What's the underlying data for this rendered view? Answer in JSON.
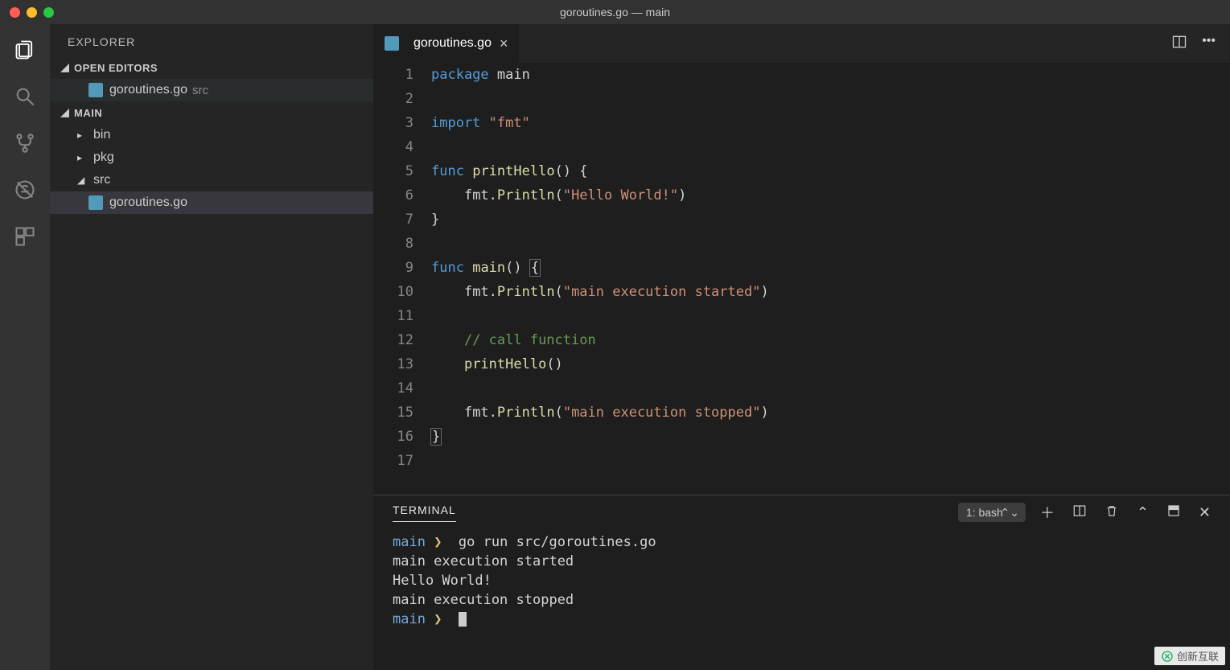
{
  "window": {
    "title": "goroutines.go — main"
  },
  "sidebar": {
    "title": "EXPLORER",
    "open_editors_label": "OPEN EDITORS",
    "open_editors": [
      {
        "name": "goroutines.go",
        "path": "src"
      }
    ],
    "workspace_label": "MAIN",
    "tree": [
      {
        "name": "bin",
        "type": "folder",
        "expanded": false
      },
      {
        "name": "pkg",
        "type": "folder",
        "expanded": false
      },
      {
        "name": "src",
        "type": "folder",
        "expanded": true,
        "children": [
          {
            "name": "goroutines.go",
            "type": "file",
            "active": true
          }
        ]
      }
    ]
  },
  "tabs": {
    "active": {
      "name": "goroutines.go"
    },
    "actions": {
      "split": "split-editor-icon",
      "more": "…"
    }
  },
  "code": {
    "raw": "package main\n\nimport \"fmt\"\n\nfunc printHello() {\n    fmt.Println(\"Hello World!\")\n}\n\nfunc main() {\n    fmt.Println(\"main execution started\")\n\n    // call function\n    printHello()\n\n    fmt.Println(\"main execution stopped\")\n}\n",
    "lines": [
      {
        "n": 1,
        "tokens": [
          [
            "package",
            "kw"
          ],
          [
            " ",
            "p"
          ],
          [
            "main",
            "id"
          ]
        ]
      },
      {
        "n": 2,
        "tokens": []
      },
      {
        "n": 3,
        "tokens": [
          [
            "import",
            "kw"
          ],
          [
            " ",
            "p"
          ],
          [
            "\"fmt\"",
            "str"
          ]
        ]
      },
      {
        "n": 4,
        "tokens": []
      },
      {
        "n": 5,
        "tokens": [
          [
            "func",
            "kw"
          ],
          [
            " ",
            "p"
          ],
          [
            "printHello",
            "fn"
          ],
          [
            "() {",
            "p"
          ]
        ]
      },
      {
        "n": 6,
        "tokens": [
          [
            "    ",
            "p"
          ],
          [
            "fmt",
            "id"
          ],
          [
            ".",
            "p"
          ],
          [
            "Println",
            "fn"
          ],
          [
            "(",
            "p"
          ],
          [
            "\"Hello World!\"",
            "str"
          ],
          [
            ")",
            "p"
          ]
        ]
      },
      {
        "n": 7,
        "tokens": [
          [
            "}",
            "p"
          ]
        ]
      },
      {
        "n": 8,
        "tokens": []
      },
      {
        "n": 9,
        "tokens": [
          [
            "func",
            "kw"
          ],
          [
            " ",
            "p"
          ],
          [
            "main",
            "fn"
          ],
          [
            "() ",
            "p"
          ],
          [
            "{",
            "box"
          ]
        ]
      },
      {
        "n": 10,
        "tokens": [
          [
            "    ",
            "p"
          ],
          [
            "fmt",
            "id"
          ],
          [
            ".",
            "p"
          ],
          [
            "Println",
            "fn"
          ],
          [
            "(",
            "p"
          ],
          [
            "\"main execution started\"",
            "str"
          ],
          [
            ")",
            "p"
          ]
        ]
      },
      {
        "n": 11,
        "tokens": []
      },
      {
        "n": 12,
        "tokens": [
          [
            "    ",
            "p"
          ],
          [
            "// call function",
            "cm"
          ]
        ]
      },
      {
        "n": 13,
        "tokens": [
          [
            "    ",
            "p"
          ],
          [
            "printHello",
            "fn"
          ],
          [
            "()",
            "p"
          ]
        ]
      },
      {
        "n": 14,
        "tokens": []
      },
      {
        "n": 15,
        "tokens": [
          [
            "    ",
            "p"
          ],
          [
            "fmt",
            "id"
          ],
          [
            ".",
            "p"
          ],
          [
            "Println",
            "fn"
          ],
          [
            "(",
            "p"
          ],
          [
            "\"main execution stopped\"",
            "str"
          ],
          [
            ")",
            "p"
          ]
        ]
      },
      {
        "n": 16,
        "tokens": [
          [
            "}",
            "box"
          ]
        ]
      },
      {
        "n": 17,
        "tokens": []
      }
    ]
  },
  "terminal": {
    "tab_label": "TERMINAL",
    "shell": "1: bash",
    "prompt_path": "main",
    "lines": [
      {
        "type": "cmd",
        "text": "go run src/goroutines.go"
      },
      {
        "type": "out",
        "text": "main execution started"
      },
      {
        "type": "out",
        "text": "Hello World!"
      },
      {
        "type": "out",
        "text": "main execution stopped"
      },
      {
        "type": "cmd",
        "text": ""
      }
    ]
  },
  "watermark": "创新互联"
}
